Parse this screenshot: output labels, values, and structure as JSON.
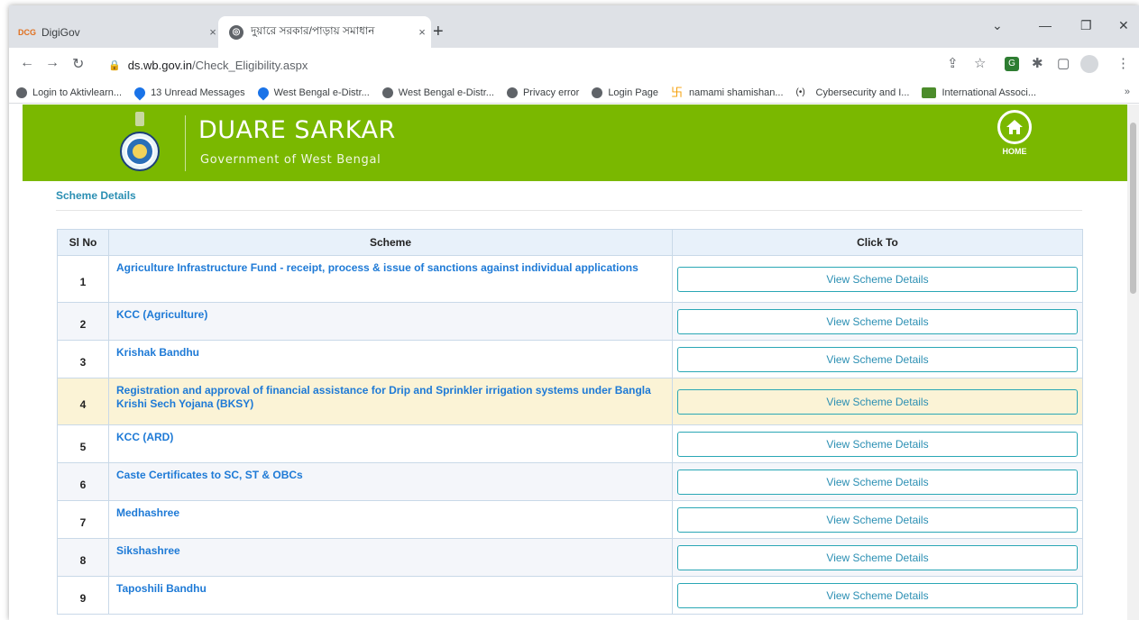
{
  "browser": {
    "tabs": [
      {
        "favicon": "digigov-icon",
        "favicon_text": "DCG",
        "title": "DigiGov",
        "close": "×"
      },
      {
        "favicon": "globe-icon",
        "title": "দুয়ারে সরকার/পাড়ায় সমাধান",
        "close": "×"
      }
    ],
    "new_tab": "+",
    "url_host": "ds.wb.gov.in",
    "url_path": "/Check_Eligibility.aspx",
    "bookmarks": [
      {
        "icon": "globe",
        "label": "Login to Aktivlearn..."
      },
      {
        "icon": "drop",
        "label": "13 Unread Messages"
      },
      {
        "icon": "drop",
        "label": "West Bengal e-Distr..."
      },
      {
        "icon": "globe",
        "label": "West Bengal e-Distr..."
      },
      {
        "icon": "globe",
        "label": "Privacy error"
      },
      {
        "icon": "globe",
        "label": "Login Page"
      },
      {
        "icon": "swastika",
        "label": "namami shamishan..."
      },
      {
        "icon": "cyber",
        "label": "Cybersecurity and I..."
      },
      {
        "icon": "intl",
        "label": "International Associ..."
      }
    ],
    "bookmarks_more": "»"
  },
  "header": {
    "title": "DUARE SARKAR",
    "subtitle": "Government of West Bengal",
    "home_label": "HOME"
  },
  "section_title": "Scheme Details",
  "table": {
    "columns": [
      "Sl No",
      "Scheme",
      "Click To"
    ],
    "rows": [
      {
        "sl": "1",
        "scheme": "Agriculture Infrastructure Fund - receipt, process & issue of sanctions against individual applications",
        "action": "View Scheme Details"
      },
      {
        "sl": "2",
        "scheme": "KCC (Agriculture)",
        "action": "View Scheme Details"
      },
      {
        "sl": "3",
        "scheme": "Krishak Bandhu",
        "action": "View Scheme Details"
      },
      {
        "sl": "4",
        "scheme": "Registration and approval of financial assistance for Drip and Sprinkler irrigation systems under Bangla Krishi Sech Yojana (BKSY)",
        "action": "View Scheme Details"
      },
      {
        "sl": "5",
        "scheme": "KCC (ARD)",
        "action": "View Scheme Details"
      },
      {
        "sl": "6",
        "scheme": "Caste Certificates to SC, ST & OBCs",
        "action": "View Scheme Details"
      },
      {
        "sl": "7",
        "scheme": "Medhashree",
        "action": "View Scheme Details"
      },
      {
        "sl": "8",
        "scheme": "Sikshashree",
        "action": "View Scheme Details"
      },
      {
        "sl": "9",
        "scheme": "Taposhili Bandhu",
        "action": "View Scheme Details"
      }
    ]
  },
  "colors": {
    "banner": "#7ab800",
    "link": "#1e7ad6",
    "button_border": "#2aa7b5",
    "highlight_row": "#fbf3d6"
  }
}
